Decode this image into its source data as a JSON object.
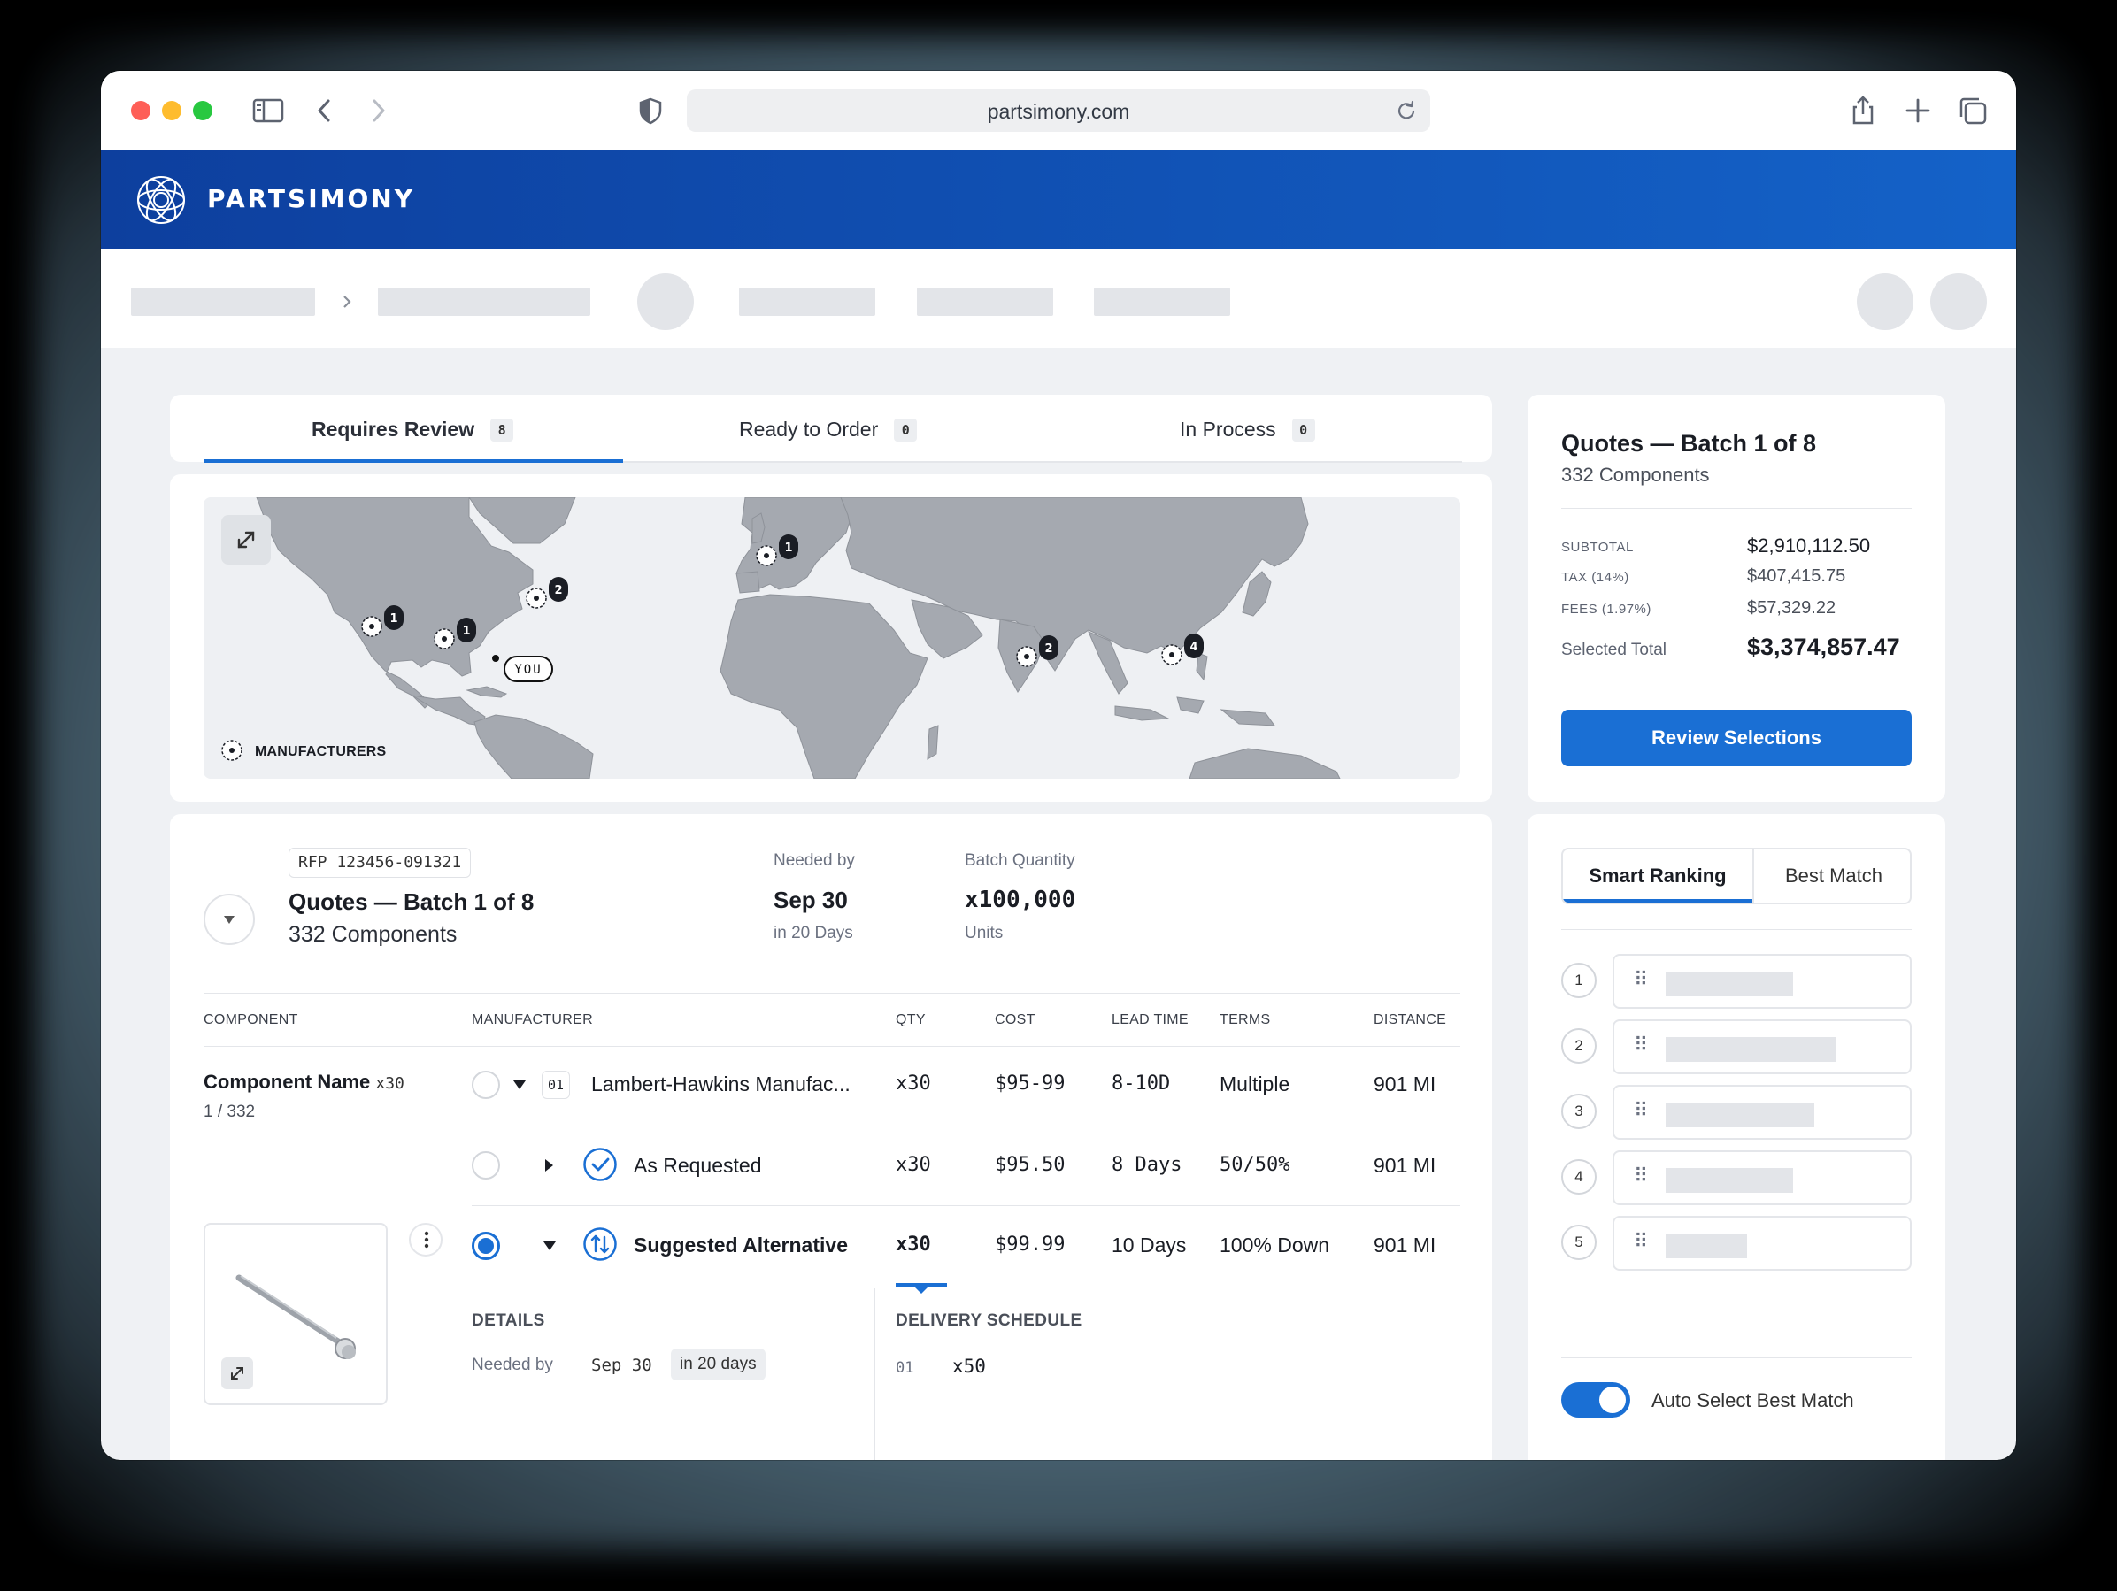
{
  "browser": {
    "url": "partsimony.com"
  },
  "brand": {
    "name": "PARTSIMONY"
  },
  "tabs": [
    {
      "label": "Requires Review",
      "count": "8"
    },
    {
      "label": "Ready to Order",
      "count": "0"
    },
    {
      "label": "In Process",
      "count": "0"
    }
  ],
  "map": {
    "legend": "MANUFACTURERS",
    "you_label": "YOU",
    "pins": [
      {
        "region": "us-west",
        "count": "1"
      },
      {
        "region": "us-south",
        "count": "1"
      },
      {
        "region": "us-east",
        "count": "2"
      },
      {
        "region": "europe",
        "count": "1"
      },
      {
        "region": "india",
        "count": "2"
      },
      {
        "region": "east-asia",
        "count": "4"
      }
    ]
  },
  "summary": {
    "title": "Quotes — Batch 1 of 8",
    "subtitle": "332 Components",
    "subtotal_label": "SUBTOTAL",
    "subtotal": "$2,910,112.50",
    "tax_label": "TAX (14%)",
    "tax": "$407,415.75",
    "fees_label": "FEES (1.97%)",
    "fees": "$57,329.22",
    "total_label": "Selected Total",
    "total": "$3,374,857.47",
    "button": "Review Selections"
  },
  "batch": {
    "rfp": "RFP 123456-091321",
    "title": "Quotes — Batch 1 of 8",
    "components": "332 Components",
    "needed_label": "Needed by",
    "needed_date": "Sep 30",
    "needed_in": "in 20 Days",
    "qty_label": "Batch Quantity",
    "qty": "x100,000",
    "qty_unit": "Units"
  },
  "table": {
    "headers": [
      "COMPONENT",
      "MANUFACTURER",
      "QTY",
      "COST",
      "LEAD TIME",
      "TERMS",
      "DISTANCE"
    ],
    "component_name": "Component Name",
    "component_qty": "x30",
    "component_index": "1 / 332",
    "rows": [
      {
        "index": "01",
        "name": "Lambert-Hawkins Manufac...",
        "qty": "x30",
        "cost": "$95-99",
        "lead": "8-10D",
        "terms": "Multiple",
        "distance": "901 MI"
      },
      {
        "name": "As Requested",
        "qty": "x30",
        "cost": "$95.50",
        "lead": "8 Days",
        "terms": "50/50%",
        "distance": "901 MI"
      },
      {
        "name": "Suggested Alternative",
        "qty": "x30",
        "cost": "$99.99",
        "lead": "10 Days",
        "terms": "100% Down",
        "distance": "901 MI"
      }
    ],
    "details_label": "DETAILS",
    "details_needed_label": "Needed by",
    "details_needed_date": "Sep 30",
    "details_needed_in": "in 20 days",
    "delivery_label": "DELIVERY SCHEDULE",
    "delivery_index": "01",
    "delivery_qty": "x50"
  },
  "ranking": {
    "tab_smart": "Smart Ranking",
    "tab_best": "Best Match",
    "items": [
      "1",
      "2",
      "3",
      "4",
      "5"
    ],
    "toggle_label": "Auto Select Best Match"
  },
  "colors": {
    "accent": "#1a6fd4",
    "brand_dark": "#0d3f9e"
  }
}
